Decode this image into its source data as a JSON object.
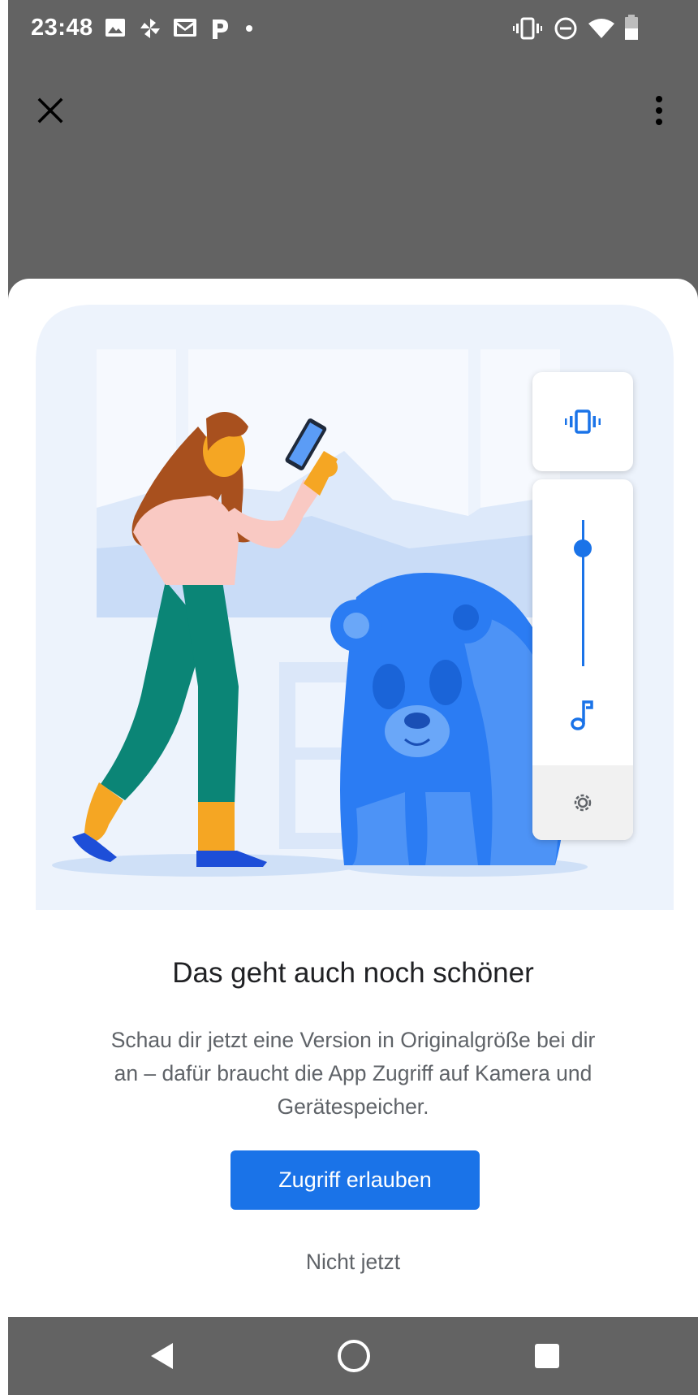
{
  "status_bar": {
    "time": "23:48",
    "left_icons": [
      "image-icon",
      "pinwheel-icon",
      "gmail-icon",
      "p-app-icon",
      "notification-dot-icon"
    ],
    "right_icons": [
      "vibrate-icon",
      "do-not-disturb-icon",
      "wifi-icon",
      "battery-icon"
    ]
  },
  "app_bar": {
    "close_icon": "close-icon",
    "more_icon": "more-vert-icon"
  },
  "dialog": {
    "title": "Das geht auch noch schöner",
    "body": "Schau dir jetzt eine Version in Originalgröße bei dir an – dafür braucht die App Zugriff auf Kamera und Gerätespeicher.",
    "primary_button": "Zugriff erlauben",
    "secondary_button": "Nicht jetzt"
  },
  "volume_panel": {
    "icons": [
      "vibrate-icon",
      "music-note-icon",
      "settings-icon"
    ],
    "level": 0.85
  },
  "nav_bar": {
    "icons": [
      "back-icon",
      "home-icon",
      "recents-icon"
    ]
  },
  "colors": {
    "accent": "#1a73e8",
    "scrim": "#636363",
    "title": "#202124",
    "body": "#5f6368"
  }
}
